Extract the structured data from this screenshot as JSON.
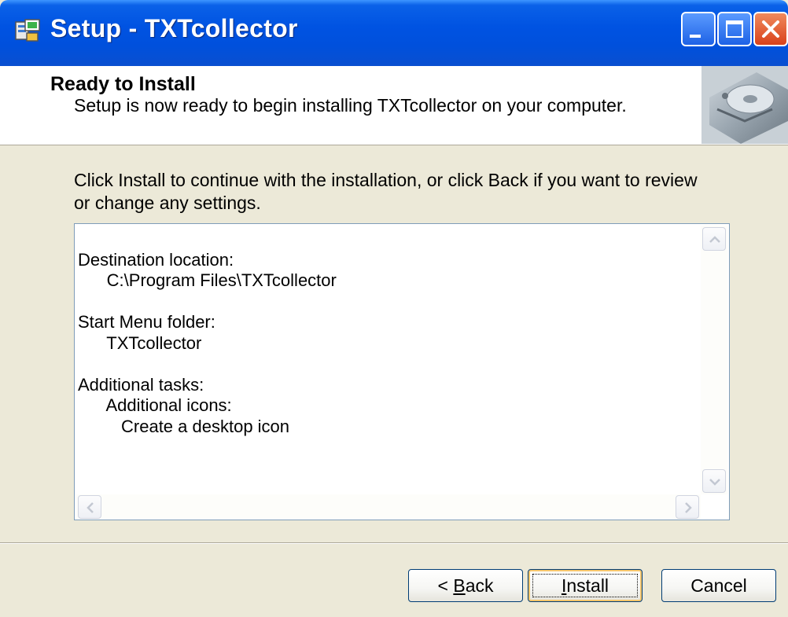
{
  "window": {
    "title": "Setup - TXTcollector",
    "icons": [
      "setup-app-icon",
      "minimize-icon",
      "maximize-icon",
      "close-icon"
    ]
  },
  "header": {
    "title": "Ready to Install",
    "subtitle": "Setup is now ready to begin installing TXTcollector on your computer.",
    "image": "hard-drive-icon"
  },
  "intro": "Click Install to continue with the installation, or click Back if you want to review or change any settings.",
  "memo": {
    "lines": [
      "Destination location:",
      "      C:\\Program Files\\TXTcollector",
      "",
      "Start Menu folder:",
      "      TXTcollector",
      "",
      "Additional tasks:",
      "      Additional icons:",
      "         Create a desktop icon"
    ]
  },
  "buttons": {
    "back": {
      "prefix": "< ",
      "accel": "B",
      "rest": "ack"
    },
    "install": {
      "accel": "I",
      "rest": "nstall"
    },
    "cancel": "Cancel"
  },
  "colors": {
    "titlebar": "#0053e2",
    "dialog_bg": "#ece9d8",
    "close_button": "#d9411a"
  }
}
